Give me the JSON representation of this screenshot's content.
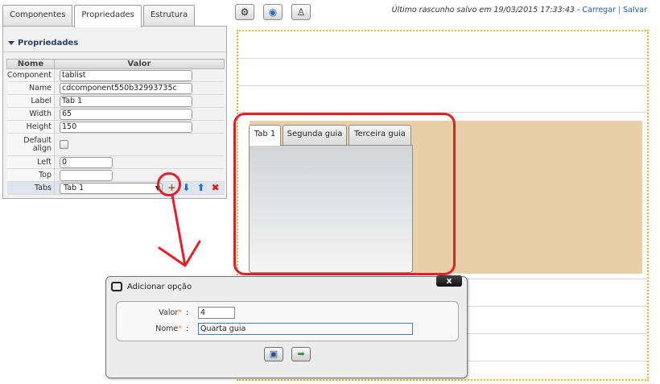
{
  "tabs": [
    {
      "label": "Componentes"
    },
    {
      "label": "Propriedades"
    },
    {
      "label": "Estrutura"
    }
  ],
  "panel": {
    "title": "Propriedades",
    "col_name": "Nome",
    "col_value": "Valor",
    "rows": [
      {
        "label": "Component",
        "value": "tablist"
      },
      {
        "label": "Name",
        "value": "cdcomponent550b32993735c"
      },
      {
        "label": "Label",
        "value": "Tab 1"
      },
      {
        "label": "Width",
        "value": "65"
      },
      {
        "label": "Height",
        "value": "150"
      },
      {
        "label": "Default align",
        "value": ""
      },
      {
        "label": "Left",
        "value": "0"
      },
      {
        "label": "Top",
        "value": ""
      },
      {
        "label": "Tabs",
        "value": "Tab 1"
      }
    ]
  },
  "toolbar": {
    "icons": [
      "gear-icon",
      "globe-icon",
      "paintbrush-icon"
    ]
  },
  "status": {
    "message": "Último rascunho salvo em 19/03/2015 17:33:43 -",
    "load": "Carregar",
    "separator": "|",
    "save": "Salvar"
  },
  "demo_tabs": [
    {
      "label": "Tab 1"
    },
    {
      "label": "Segunda guia"
    },
    {
      "label": "Terceira guia"
    }
  ],
  "dialog": {
    "title": "Adicionar opção",
    "close": "x",
    "value_label": "Valor",
    "value": "4",
    "name_label": "Nome",
    "name": "Quarta guia",
    "required_mark": "*",
    "colon": ":"
  },
  "colors": {
    "annotation": "#e3202a",
    "canvas_border": "#e7b72a",
    "tab_area": "#e8cfa7",
    "link": "#1f5fae"
  }
}
